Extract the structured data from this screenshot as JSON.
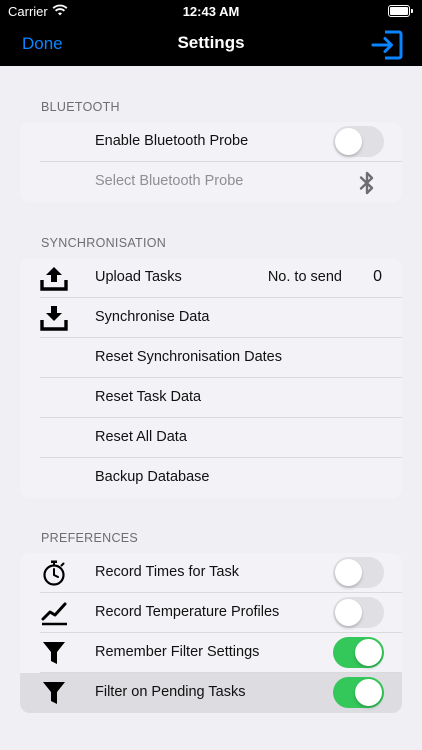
{
  "status_bar": {
    "carrier": "Carrier",
    "time": "12:43 AM"
  },
  "nav": {
    "done_label": "Done",
    "title": "Settings",
    "exit_icon": "exit-icon"
  },
  "sections": {
    "bluetooth": {
      "header": "BLUETOOTH",
      "rows": [
        {
          "label": "Enable Bluetooth Probe",
          "toggle_on": false
        },
        {
          "label": "Select Bluetooth Probe",
          "icon": "bluetooth-icon",
          "disabled": true
        }
      ]
    },
    "sync": {
      "header": "SYNCHRONISATION",
      "rows": [
        {
          "label": "Upload Tasks",
          "icon": "upload-icon",
          "detail": "No. to send",
          "count": "0"
        },
        {
          "label": "Synchronise Data",
          "icon": "download-icon"
        },
        {
          "label": "Reset Synchronisation Dates"
        },
        {
          "label": "Reset Task Data"
        },
        {
          "label": "Reset All Data"
        },
        {
          "label": "Backup Database"
        }
      ]
    },
    "preferences": {
      "header": "PREFERENCES",
      "rows": [
        {
          "label": "Record Times for Task",
          "icon": "stopwatch-icon",
          "toggle_on": false
        },
        {
          "label": "Record Temperature Profiles",
          "icon": "line-chart-icon",
          "toggle_on": false
        },
        {
          "label": "Remember Filter Settings",
          "icon": "filter-icon",
          "toggle_on": true
        },
        {
          "label": "Filter on Pending Tasks",
          "icon": "filter-icon",
          "toggle_on": true,
          "highlighted": true
        }
      ]
    }
  },
  "colors": {
    "accent": "#0a84ff",
    "toggle_on": "#34c759",
    "toggle_off": "#e0e0e4",
    "background": "#efeff4"
  }
}
